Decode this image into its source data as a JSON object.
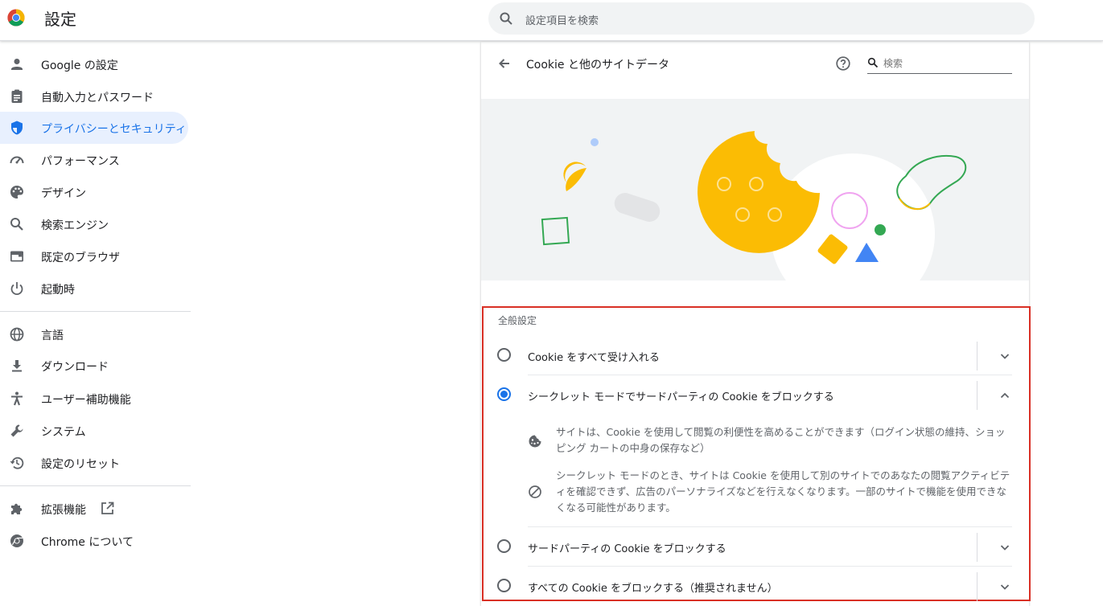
{
  "header": {
    "title": "設定",
    "search_placeholder": "設定項目を検索"
  },
  "sidebar": {
    "items": [
      {
        "label": "Google の設定",
        "icon": "person-icon"
      },
      {
        "label": "自動入力とパスワード",
        "icon": "clipboard-icon"
      },
      {
        "label": "プライバシーとセキュリティ",
        "icon": "shield-icon",
        "active": true
      },
      {
        "label": "パフォーマンス",
        "icon": "speedometer-icon"
      },
      {
        "label": "デザイン",
        "icon": "palette-icon"
      },
      {
        "label": "検索エンジン",
        "icon": "search-icon"
      },
      {
        "label": "既定のブラウザ",
        "icon": "browser-icon"
      },
      {
        "label": "起動時",
        "icon": "power-icon"
      },
      {
        "label": "言語",
        "icon": "globe-icon"
      },
      {
        "label": "ダウンロード",
        "icon": "download-icon"
      },
      {
        "label": "ユーザー補助機能",
        "icon": "accessibility-icon"
      },
      {
        "label": "システム",
        "icon": "wrench-icon"
      },
      {
        "label": "設定のリセット",
        "icon": "restore-icon"
      },
      {
        "label": "拡張機能",
        "icon": "puzzle-icon"
      },
      {
        "label": "Chrome について",
        "icon": "chrome-icon"
      }
    ]
  },
  "page": {
    "title": "Cookie と他のサイトデータ",
    "search_placeholder": "検索"
  },
  "general": {
    "title": "全般設定",
    "options": [
      {
        "label": "Cookie をすべて受け入れる",
        "selected": false,
        "expanded": false
      },
      {
        "label": "シークレット モードでサードパーティの Cookie をブロックする",
        "selected": true,
        "expanded": true
      },
      {
        "label": "サードパーティの Cookie をブロックする",
        "selected": false,
        "expanded": false
      },
      {
        "label": "すべての Cookie をブロックする（推奨されません）",
        "selected": false,
        "expanded": false
      }
    ],
    "details": [
      {
        "icon": "cookie-icon",
        "text": "サイトは、Cookie を使用して閲覧の利便性を高めることができます（ログイン状態の維持、ショッピング カートの中身の保存など）"
      },
      {
        "icon": "block-icon",
        "text": "シークレット モードのとき、サイトは Cookie を使用して別のサイトでのあなたの閲覧アクティビティを確認できず、広告のパーソナライズなどを行えなくなります。一部のサイトで機能を使用できなくなる可能性があります。"
      }
    ]
  },
  "colors": {
    "accent": "#1a73e8",
    "active_bg": "#e8f0fe",
    "highlight_border": "#d93025",
    "cookie_yellow": "#fbbc04",
    "green": "#34a853"
  }
}
